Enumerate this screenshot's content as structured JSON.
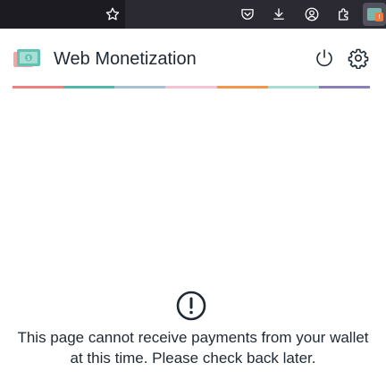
{
  "browser_toolbar": {
    "icons": [
      "star-icon",
      "pocket-icon",
      "download-icon",
      "account-icon",
      "extensions-icon",
      "web-monetization-extension-icon"
    ],
    "extension_badge": "!"
  },
  "header": {
    "title": "Web Monetization",
    "logo_icon": "web-monetization-logo-icon",
    "power_icon": "power-icon",
    "settings_icon": "settings-icon"
  },
  "stripe_colors": [
    "#f08080",
    "#4fb8a8",
    "#a6c0d4",
    "#f5c2d6",
    "#f5964a",
    "#a8ddd3",
    "#8a7fb8"
  ],
  "notice": {
    "icon": "alert-circle-icon",
    "message": "This page cannot receive payments from your wallet at this time. Please check back later."
  }
}
